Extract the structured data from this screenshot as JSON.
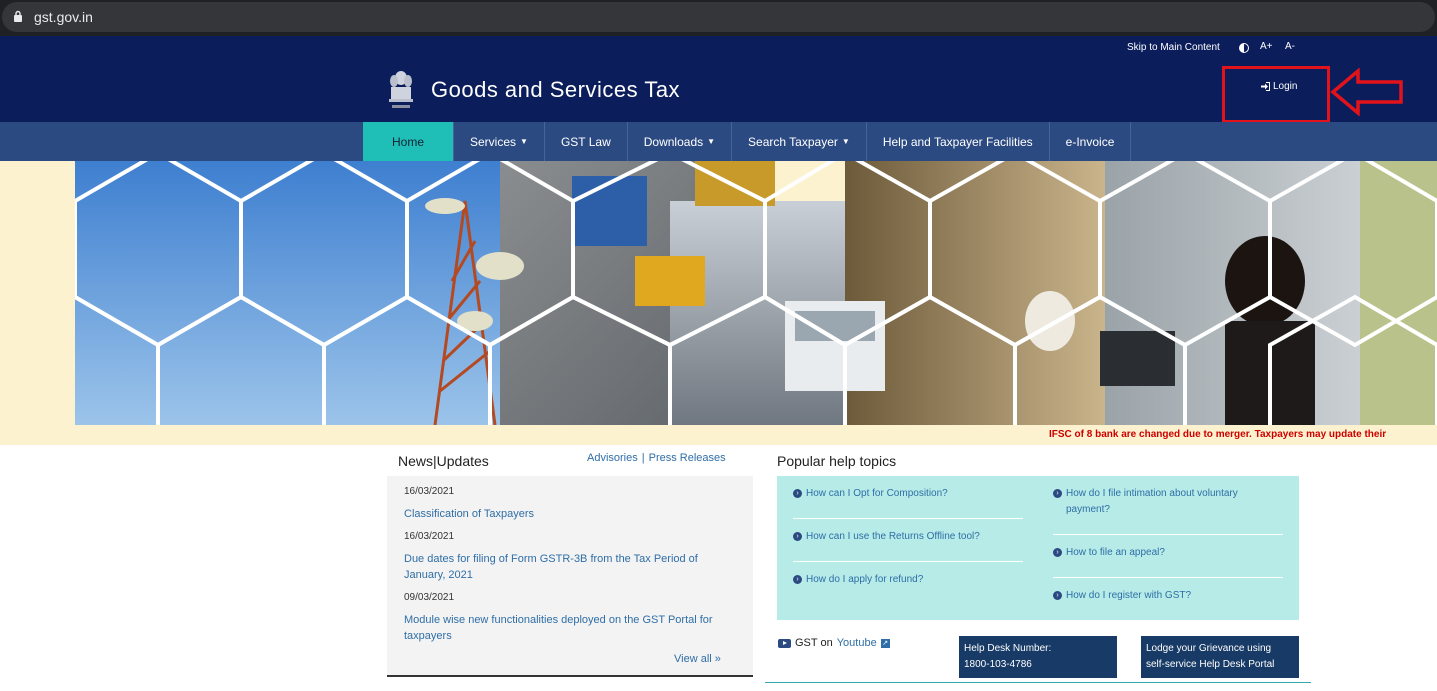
{
  "browser": {
    "url": "gst.gov.in"
  },
  "utility": {
    "skip": "Skip to Main Content",
    "font_increase": "A+",
    "font_decrease": "A-"
  },
  "header": {
    "title": "Goods and Services Tax",
    "login": "Login"
  },
  "nav": {
    "items": [
      {
        "label": "Home"
      },
      {
        "label": "Services"
      },
      {
        "label": "GST Law"
      },
      {
        "label": "Downloads"
      },
      {
        "label": "Search Taxpayer"
      },
      {
        "label": "Help and Taxpayer Facilities"
      },
      {
        "label": "e-Invoice"
      }
    ]
  },
  "ticker": "IFSC of 8 bank are changed due to merger. Taxpayers may update their",
  "news": {
    "title": "News|Updates",
    "advisories": "Advisories",
    "separator": "|",
    "press": "Press Releases",
    "items": [
      {
        "date": "16/03/2021",
        "text": "Classification of Taxpayers"
      },
      {
        "date": "16/03/2021",
        "text": "Due dates for filing of Form GSTR-3B from the Tax Period of January, 2021"
      },
      {
        "date": "09/03/2021",
        "text": "Module wise new functionalities deployed on the GST Portal for taxpayers"
      }
    ],
    "view_all": "View all »"
  },
  "help": {
    "title": "Popular help topics",
    "left": [
      "How can I Opt for Composition?",
      "How can I use the Returns Offline tool?",
      "How do I apply for refund?"
    ],
    "right": [
      "How do I file intimation about voluntary payment?",
      "How to file an appeal?",
      "How do I register with GST?"
    ]
  },
  "widgets": {
    "gst_on": "GST on",
    "youtube": "Youtube",
    "helpdesk_label": "Help Desk Number:",
    "helpdesk_number": "1800-103-4786",
    "grievance_line1": "Lodge your Grievance using",
    "grievance_line2": "self-service Help Desk Portal"
  },
  "colors": {
    "header": "#0b1e5b",
    "nav": "#2c4a82",
    "nav_active": "#1fbfb8",
    "highlight": "#e3131b",
    "help_bg": "#b6ebe7",
    "banner_bg": "#fdf2cf"
  },
  "icons": [
    "lock-icon",
    "contrast-icon",
    "emblem-icon",
    "login-icon",
    "arrow-icon",
    "youtube-icon",
    "external-link-icon"
  ]
}
